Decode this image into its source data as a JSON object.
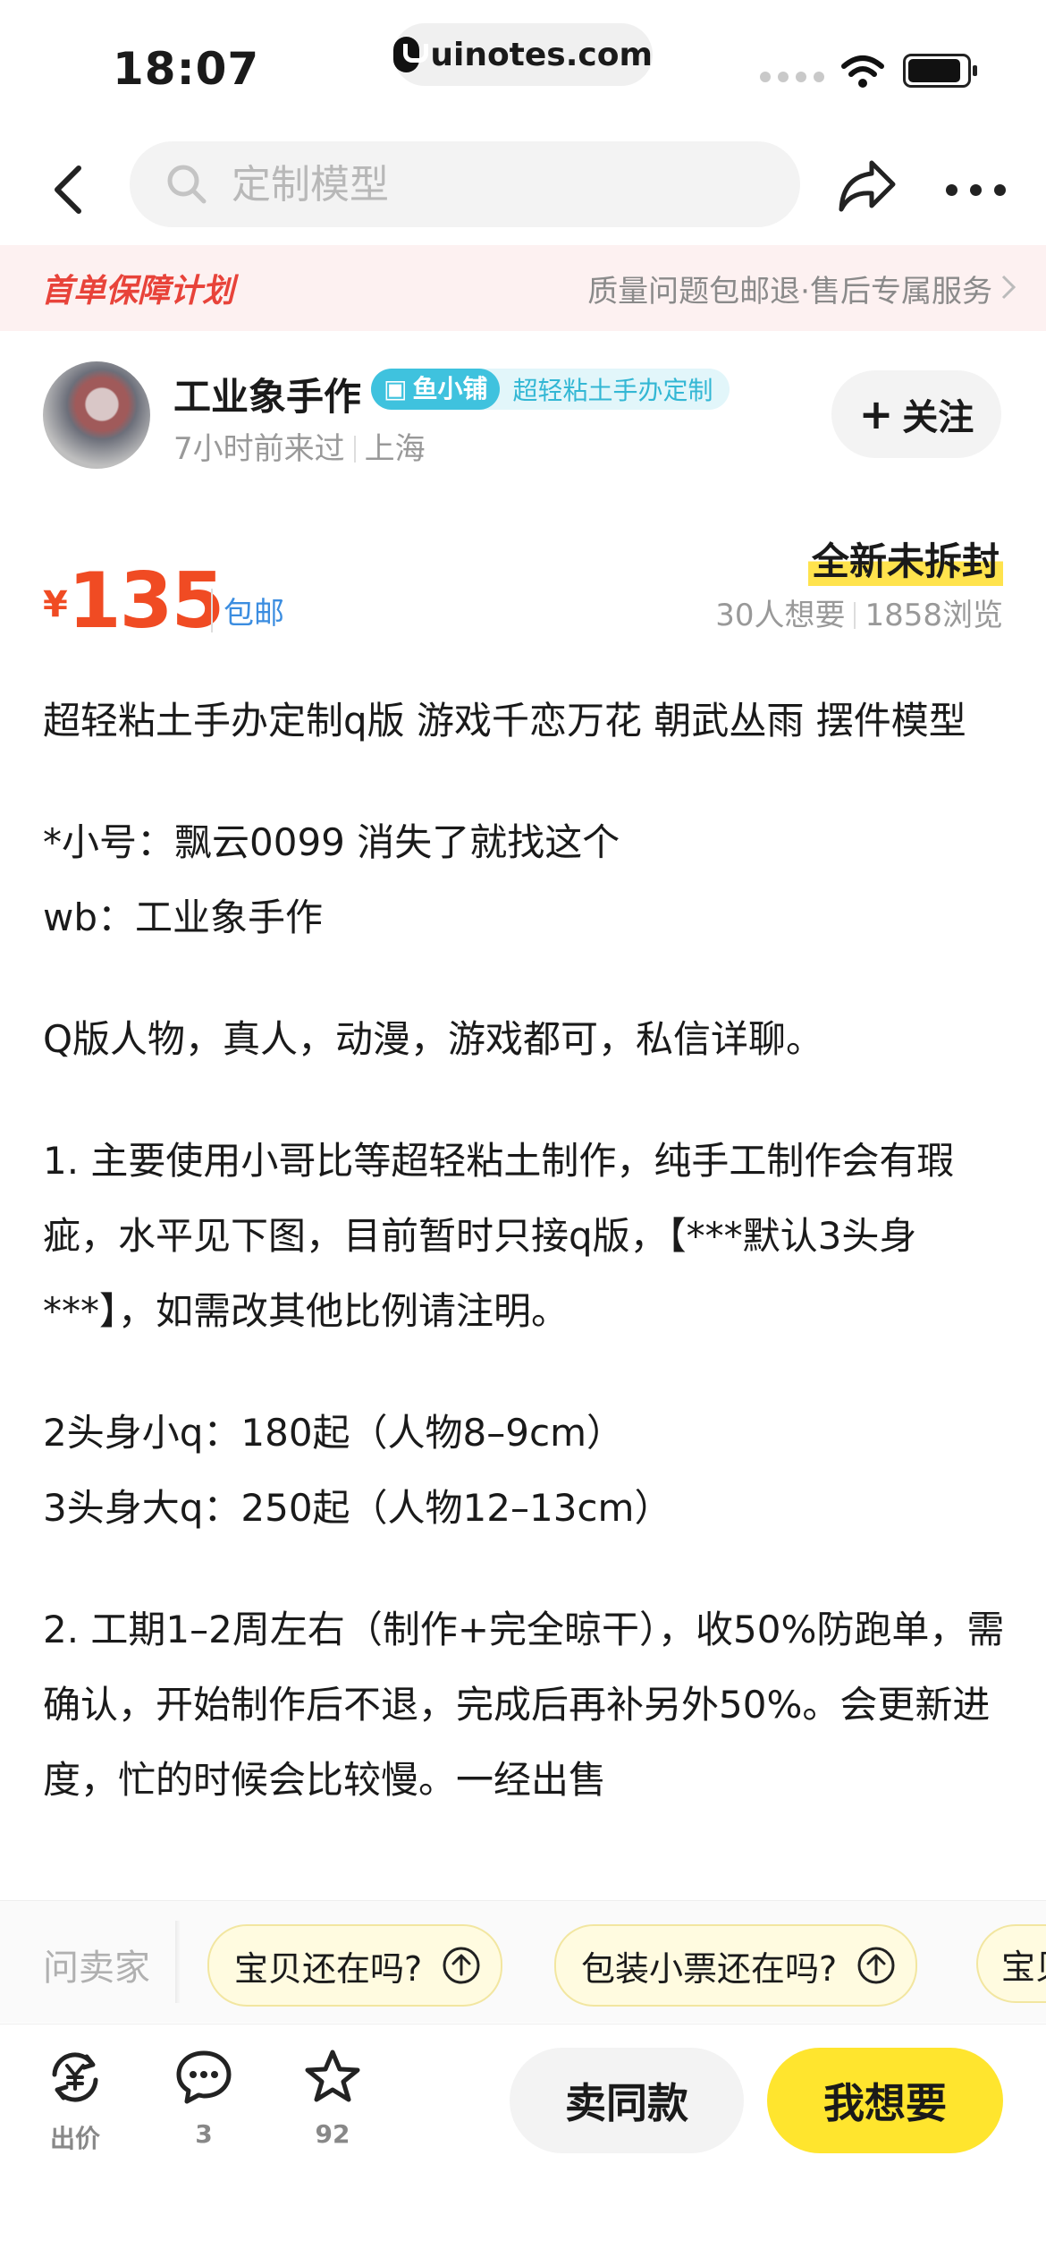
{
  "status_bar": {
    "time": "18:07",
    "site": "uinotes.com"
  },
  "search": {
    "placeholder": "定制模型"
  },
  "banner": {
    "left": "首单保障计划",
    "right": "质量问题包邮退·售后专属服务"
  },
  "seller": {
    "name": "工业象手作",
    "badge_shop": "鱼小铺",
    "badge_desc": "超轻粘土手办定制",
    "last_seen": "7小时前来过",
    "location": "上海",
    "follow_label": "关注"
  },
  "product": {
    "currency": "¥",
    "price": "135",
    "shipping": "包邮",
    "condition": "全新未拆封",
    "wants": "30人想要",
    "views": "1858浏览"
  },
  "description": [
    "超轻粘土手办定制q版 游戏千恋万花 朝武丛雨 摆件模型",
    "*小号：飘云0099 消失了就找这个\nwb：工业象手作",
    "Q版人物，真人，动漫，游戏都可，私信详聊。",
    "1. 主要使用小哥比等超轻粘土制作，纯手工制作会有瑕疵，水平见下图，目前暂时只接q版，【***默认3头身***】，如需改其他比例请注明。",
    "2头身小q：180起（人物8–9cm）\n3头身大q：250起（人物12–13cm）",
    "2. 工期1–2周左右（制作+完全晾干），收50%防跑单，需确认，开始制作后不退，完成后再补另外50%。会更新进度，忙的时候会比较慢。一经出售"
  ],
  "ask": {
    "label": "问卖家",
    "questions": [
      "宝贝还在吗?",
      "包装小票还在吗?",
      "宝贝"
    ]
  },
  "toolbar": {
    "offer_label": "出价",
    "comments_count": "3",
    "favorites_count": "92",
    "same_label": "卖同款",
    "want_label": "我想要"
  },
  "colors": {
    "price": "#f04b23",
    "accent": "#ffe52e",
    "banner_red": "#e8433a",
    "shop_badge": "#3fc2de"
  }
}
